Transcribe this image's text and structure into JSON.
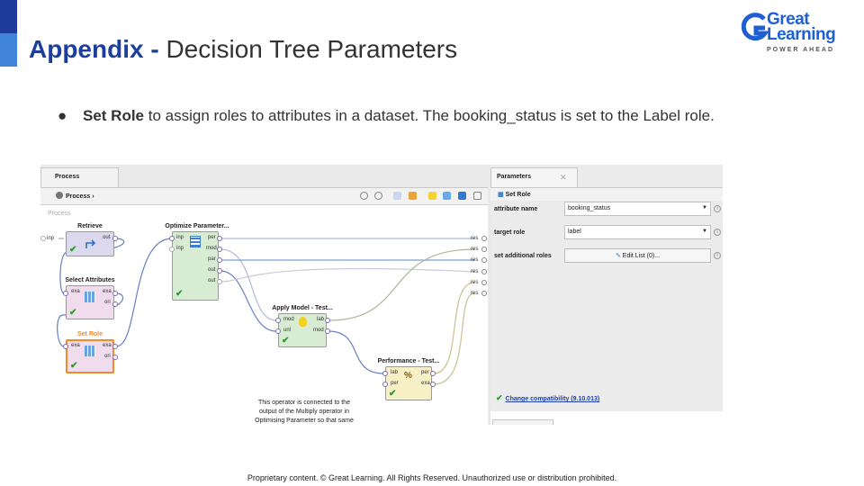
{
  "slide": {
    "title_bold": "Appendix -",
    "title_rest": "Decision Tree Parameters",
    "bullet_bold": "Set Role",
    "bullet_rest": "to assign roles to attributes in a dataset. The booking_status is set to the Label role.",
    "footer": "Proprietary content. © Great Learning. All Rights Reserved. Unauthorized use or distribution prohibited."
  },
  "logo": {
    "line1": "Great",
    "line2": "Learning",
    "tagline": "POWER AHEAD"
  },
  "process_panel": {
    "tab": "Process",
    "crumb": "Process",
    "canvas_label": "Process",
    "operators": {
      "retrieve": {
        "title": "Retrieve",
        "out": "out"
      },
      "select_attributes": {
        "title": "Select Attributes",
        "in": "exa",
        "out1": "exa",
        "out2": "ori"
      },
      "set_role": {
        "title": "Set Role",
        "in": "exa",
        "out1": "exa",
        "out2": "ori"
      },
      "optimize": {
        "title": "Optimize Parameter...",
        "in1": "inp",
        "in2": "inp",
        "out1": "per",
        "out2": "mod",
        "out3": "par",
        "out4": "out",
        "out5": "out"
      },
      "apply_model": {
        "title": "Apply Model - Test...",
        "in1": "mod",
        "in2": "unl",
        "out1": "lab",
        "out2": "mod"
      },
      "performance": {
        "title": "Performance - Test...",
        "in1": "lab",
        "in2": "per",
        "out1": "per",
        "out2": "exa"
      }
    },
    "left_port": "inp",
    "res_ports": [
      "res",
      "res",
      "res",
      "res",
      "res",
      "res"
    ],
    "note": "This operator is connected to the output of the Multiply operator in Optimising Parameter so that same model \"decision Tree\" can be used for Testing sets as well."
  },
  "parameters_panel": {
    "tab": "Parameters",
    "operator": "Set Role",
    "rows": [
      {
        "label": "attribute name",
        "value": "booking_status"
      },
      {
        "label": "target role",
        "value": "label"
      },
      {
        "label": "set additional roles",
        "button": "Edit List (0)..."
      }
    ],
    "compat": "Change compatibility (9.10.013)"
  },
  "colors": {
    "accent_dark": "#1f3c9a",
    "accent_light": "#3f84d8",
    "brand_blue": "#1c3f9e",
    "set_role_orange": "#f08a2a"
  }
}
